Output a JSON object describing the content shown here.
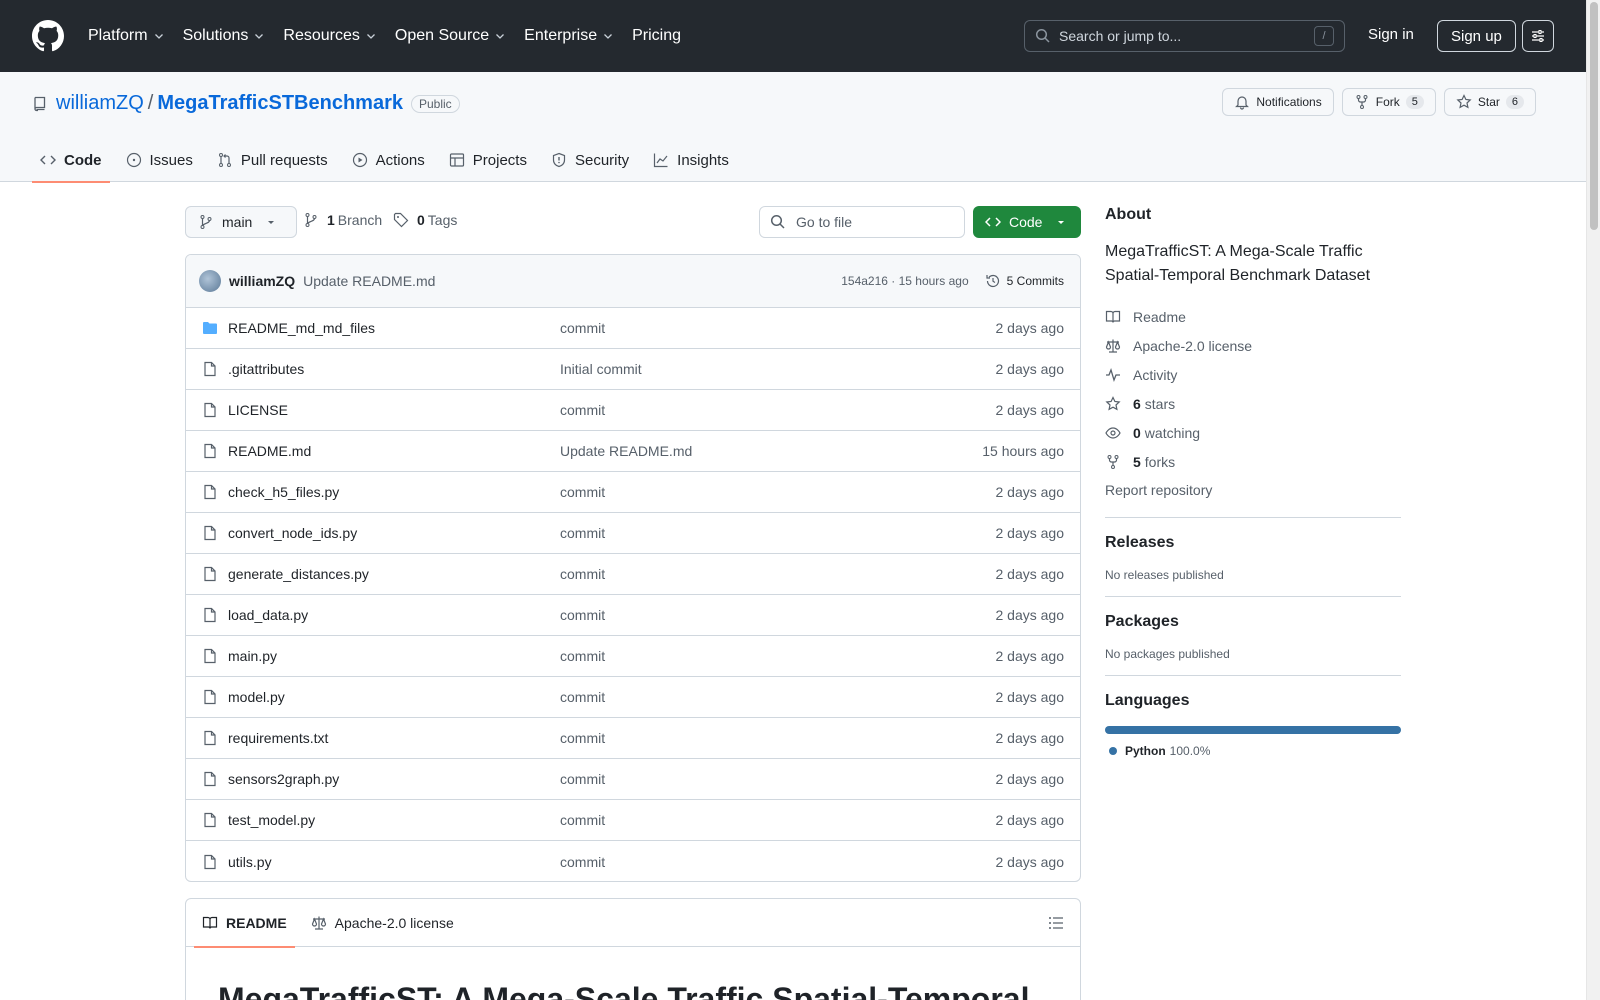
{
  "header": {
    "nav": [
      "Platform",
      "Solutions",
      "Resources",
      "Open Source",
      "Enterprise",
      "Pricing"
    ],
    "search_placeholder": "Search or jump to...",
    "search_key": "/",
    "signin": "Sign in",
    "signup": "Sign up"
  },
  "repo": {
    "owner": "williamZQ",
    "separator": "/",
    "name": "MegaTrafficSTBenchmark",
    "visibility": "Public",
    "notifications": "Notifications",
    "fork_label": "Fork",
    "fork_count": "5",
    "star_label": "Star",
    "star_count": "6"
  },
  "tabs": [
    {
      "label": "Code",
      "icon": "code-icon",
      "active": true
    },
    {
      "label": "Issues",
      "icon": "issue-icon"
    },
    {
      "label": "Pull requests",
      "icon": "pull-request-icon"
    },
    {
      "label": "Actions",
      "icon": "play-icon"
    },
    {
      "label": "Projects",
      "icon": "table-icon"
    },
    {
      "label": "Security",
      "icon": "shield-icon"
    },
    {
      "label": "Insights",
      "icon": "graph-icon"
    }
  ],
  "toolbar": {
    "branch": "main",
    "branch_count": "1",
    "branch_label": "Branch",
    "tag_count": "0",
    "tag_label": "Tags",
    "goto_placeholder": "Go to file",
    "code_label": "Code"
  },
  "latest_commit": {
    "author": "williamZQ",
    "message": "Update README.md",
    "meta": "154a216 · 15 hours ago",
    "commits": "5 Commits"
  },
  "files": [
    {
      "name": "README_md_md_files",
      "type": "folder",
      "commit": "commit",
      "date": "2 days ago"
    },
    {
      "name": ".gitattributes",
      "type": "file",
      "commit": "Initial commit",
      "date": "2 days ago"
    },
    {
      "name": "LICENSE",
      "type": "file",
      "commit": "commit",
      "date": "2 days ago"
    },
    {
      "name": "README.md",
      "type": "file",
      "commit": "Update README.md",
      "date": "15 hours ago"
    },
    {
      "name": "check_h5_files.py",
      "type": "file",
      "commit": "commit",
      "date": "2 days ago"
    },
    {
      "name": "convert_node_ids.py",
      "type": "file",
      "commit": "commit",
      "date": "2 days ago"
    },
    {
      "name": "generate_distances.py",
      "type": "file",
      "commit": "commit",
      "date": "2 days ago"
    },
    {
      "name": "load_data.py",
      "type": "file",
      "commit": "commit",
      "date": "2 days ago"
    },
    {
      "name": "main.py",
      "type": "file",
      "commit": "commit",
      "date": "2 days ago"
    },
    {
      "name": "model.py",
      "type": "file",
      "commit": "commit",
      "date": "2 days ago"
    },
    {
      "name": "requirements.txt",
      "type": "file",
      "commit": "commit",
      "date": "2 days ago"
    },
    {
      "name": "sensors2graph.py",
      "type": "file",
      "commit": "commit",
      "date": "2 days ago"
    },
    {
      "name": "test_model.py",
      "type": "file",
      "commit": "commit",
      "date": "2 days ago"
    },
    {
      "name": "utils.py",
      "type": "file",
      "commit": "commit",
      "date": "2 days ago"
    }
  ],
  "readme": {
    "tab_readme": "README",
    "tab_license": "Apache-2.0 license",
    "heading": "MegaTrafficST: A Mega-Scale Traffic Spatial-Temporal"
  },
  "about": {
    "title": "About",
    "description": "MegaTrafficST: A Mega-Scale Traffic Spatial-Temporal Benchmark Dataset",
    "readme": "Readme",
    "license": "Apache-2.0 license",
    "activity": "Activity",
    "stars_count": "6",
    "stars_label": "stars",
    "watching_count": "0",
    "watching_label": "watching",
    "forks_count": "5",
    "forks_label": "forks",
    "report": "Report repository"
  },
  "releases": {
    "title": "Releases",
    "empty": "No releases published"
  },
  "packages": {
    "title": "Packages",
    "empty": "No packages published"
  },
  "languages": {
    "title": "Languages",
    "items": [
      {
        "name": "Python",
        "percent": "100.0%",
        "fraction": 1.0,
        "color": "#3572A5"
      }
    ]
  }
}
